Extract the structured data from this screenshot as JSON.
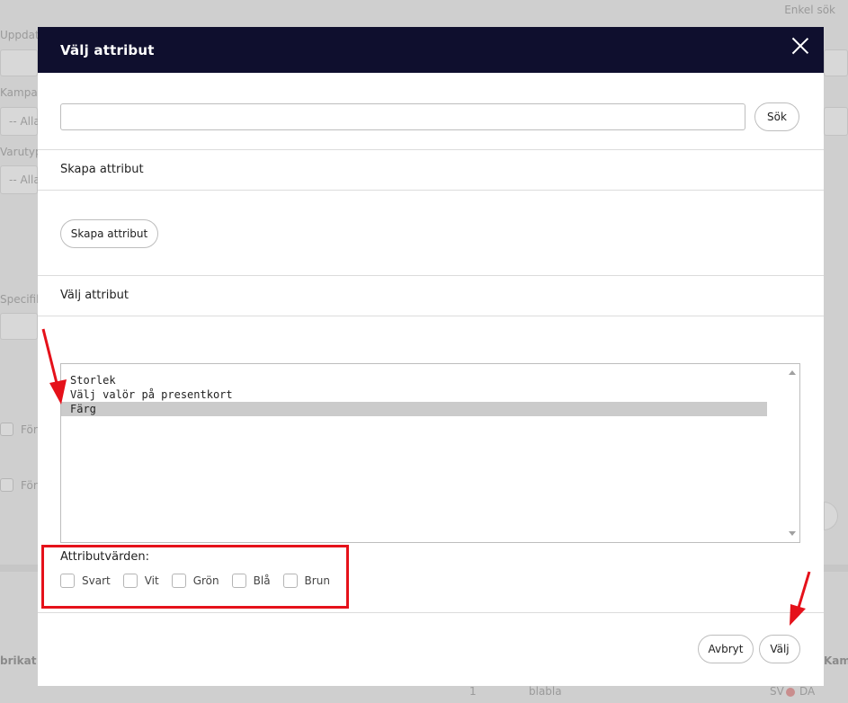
{
  "background": {
    "enkel_sok": "Enkel sök",
    "uppdat": "Uppdat",
    "kampa": "Kampa",
    "alla1": "-- Alla",
    "varutyp": "Varutyp",
    "alla2": "-- Alla",
    "specifik": "Specifik",
    "for1": "För",
    "for2": "För",
    "brikat": "brikat",
    "kamp": "Kamp",
    "row_num": "1",
    "row_name": "blabla",
    "sv": "SV",
    "da": "DA"
  },
  "modal": {
    "title": "Välj attribut",
    "search": {
      "value": "",
      "placeholder": "",
      "button": "Sök"
    },
    "create_section": {
      "title": "Skapa attribut",
      "button": "Skapa attribut"
    },
    "choose_section": {
      "title": "Välj attribut",
      "options": [
        "Storlek",
        "Välj valör på presentkort",
        "Färg"
      ],
      "selected": "Färg"
    },
    "attribute_values": {
      "title": "Attributvärden:",
      "items": [
        "Svart",
        "Vit",
        "Grön",
        "Blå",
        "Brun"
      ]
    },
    "footer": {
      "cancel": "Avbryt",
      "choose": "Välj"
    }
  },
  "colors": {
    "header_bg": "#0f0f2e",
    "annotation_red": "#e5111a",
    "selected_bg": "#cbcbcb"
  }
}
